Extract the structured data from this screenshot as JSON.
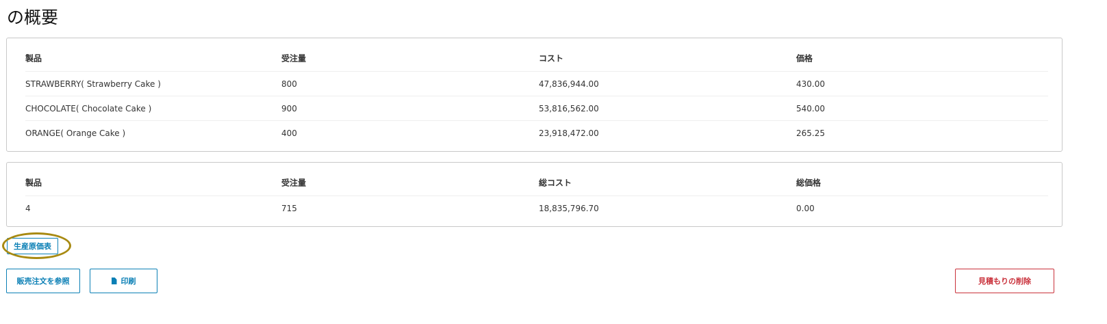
{
  "page": {
    "title": "の概要"
  },
  "items_table": {
    "headers": [
      "製品",
      "受注量",
      "コスト",
      "価格"
    ],
    "rows": [
      [
        "STRAWBERRY( Strawberry Cake )",
        "800",
        "47,836,944.00",
        "430.00"
      ],
      [
        "CHOCOLATE( Chocolate Cake )",
        "900",
        "53,816,562.00",
        "540.00"
      ],
      [
        "ORANGE( Orange Cake )",
        "400",
        "23,918,472.00",
        "265.25"
      ]
    ]
  },
  "totals_table": {
    "headers": [
      "製品",
      "受注量",
      "総コスト",
      "総価格"
    ],
    "rows": [
      [
        "4",
        "715",
        "18,835,796.70",
        "0.00"
      ]
    ]
  },
  "buttons": {
    "cost_sheet": "生産原価表",
    "view_sales_order": "販売注文を参照",
    "print": "印刷",
    "delete_quote": "見積もりの削除"
  },
  "icons": {
    "print": "document-icon"
  },
  "colors": {
    "primary": "#0a7fb5",
    "danger": "#c9303a",
    "highlight": "#a88a12"
  }
}
